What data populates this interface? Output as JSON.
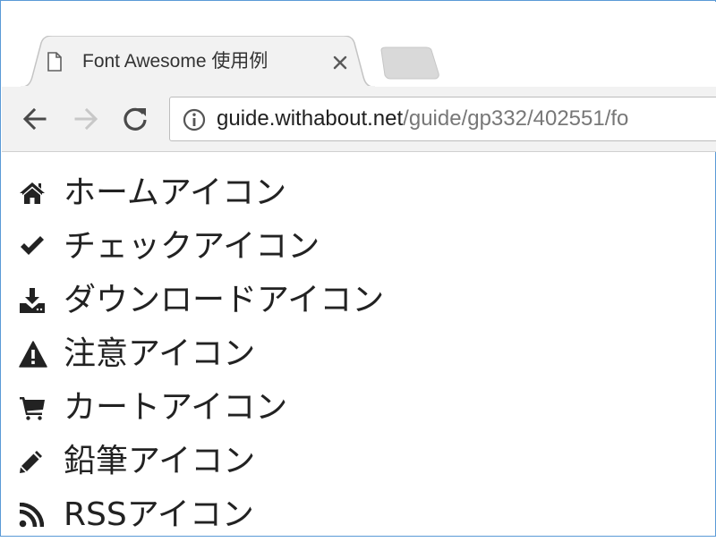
{
  "browser": {
    "tab": {
      "title": "Font Awesome 使用例",
      "icon": "page-icon",
      "close_icon": "close-icon"
    },
    "new_tab_icon": "new-tab-icon",
    "toolbar": {
      "back_icon": "back-arrow-icon",
      "forward_icon": "forward-arrow-icon",
      "reload_icon": "reload-icon",
      "site_info_icon": "info-icon",
      "url_host": "guide.withabout.net",
      "url_path": "/guide/gp332/402551/fo"
    }
  },
  "content": {
    "items": [
      {
        "icon": "home-icon",
        "label": "ホームアイコン"
      },
      {
        "icon": "check-icon",
        "label": "チェックアイコン"
      },
      {
        "icon": "download-icon",
        "label": "ダウンロードアイコン"
      },
      {
        "icon": "warning-icon",
        "label": "注意アイコン"
      },
      {
        "icon": "cart-icon",
        "label": "カートアイコン"
      },
      {
        "icon": "pencil-icon",
        "label": "鉛筆アイコン"
      },
      {
        "icon": "rss-icon",
        "label": "RSSアイコン"
      }
    ]
  },
  "colors": {
    "frame_border": "#5a9ad6",
    "toolbar_bg": "#f2f2f2",
    "url_path": "#777777",
    "icon": "#222222"
  }
}
